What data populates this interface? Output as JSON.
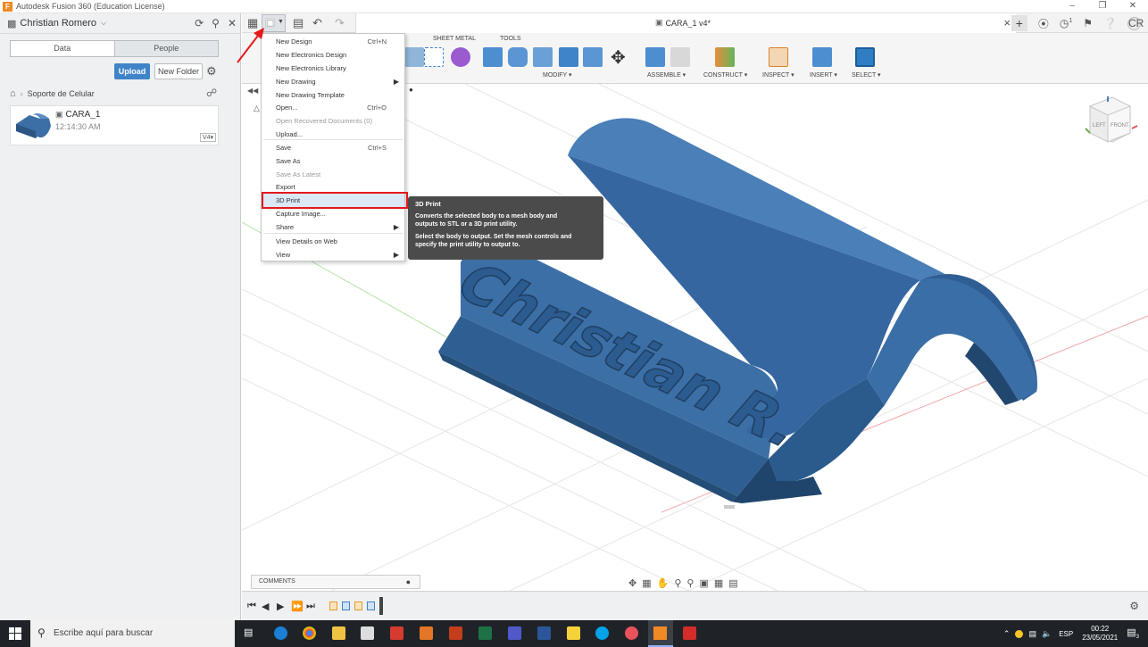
{
  "window": {
    "title": "Autodesk Fusion 360 (Education License)",
    "logo": "F"
  },
  "data_panel": {
    "user": "Christian Romero",
    "tabs": [
      "Data",
      "People"
    ],
    "upload_label": "Upload",
    "new_folder_label": "New Folder",
    "breadcrumb": "Soporte de Celular",
    "file": {
      "name": "CARA_1",
      "time": "12:14:30 AM",
      "version": "V4▾"
    }
  },
  "document": {
    "tab_name": "CARA_1 v4*",
    "jobs_count": "1",
    "user_initials": "CR"
  },
  "ribbon": {
    "tabs": [
      "SHEET METAL",
      "TOOLS"
    ],
    "groups": [
      "MODIFY ▾",
      "ASSEMBLE ▾",
      "CONSTRUCT ▾",
      "INSPECT ▾",
      "INSERT ▾",
      "SELECT ▾"
    ]
  },
  "file_menu": {
    "items": [
      {
        "label": "New Design",
        "shortcut": "Ctrl+N"
      },
      {
        "label": "New Electronics Design",
        "shortcut": ""
      },
      {
        "label": "New Electronics Library",
        "shortcut": ""
      },
      {
        "label": "New Drawing",
        "shortcut": ""
      },
      {
        "label": "New Drawing Template",
        "shortcut": ""
      },
      {
        "label": "Open...",
        "shortcut": "Ctrl+O"
      },
      {
        "label": "Open Recovered Documents (0)",
        "shortcut": ""
      },
      {
        "label": "Upload...",
        "shortcut": ""
      },
      {
        "label": "Save",
        "shortcut": "Ctrl+S"
      },
      {
        "label": "Save As",
        "shortcut": ""
      },
      {
        "label": "Save As Latest",
        "shortcut": ""
      },
      {
        "label": "Export",
        "shortcut": ""
      },
      {
        "label": "3D Print",
        "shortcut": ""
      },
      {
        "label": "Capture Image...",
        "shortcut": ""
      },
      {
        "label": "Share",
        "shortcut": ""
      },
      {
        "label": "View Details on Web",
        "shortcut": ""
      },
      {
        "label": "View",
        "shortcut": ""
      }
    ]
  },
  "tooltip": {
    "title": "3D Print",
    "line1": "Converts the selected body to a mesh body and",
    "line2": "outputs to STL or a 3D print utility.",
    "line3": "Select the body to output. Set the mesh controls and",
    "line4": "specify the print utility to output to."
  },
  "viewport": {
    "model_text": "Christian R.",
    "viewcube_left": "LEFT",
    "viewcube_front": "FRONT"
  },
  "comments": {
    "label": "COMMENTS"
  },
  "taskbar": {
    "search_placeholder": "Escribe aquí para buscar",
    "language": "ESP",
    "time": "00:22",
    "date": "23/05/2021",
    "notifications": "3"
  },
  "colors": {
    "accent": "#3f84c8",
    "highlight_red": "#e3191c",
    "model_blue": "#3b6fa5",
    "taskbar": "#1f2328"
  }
}
